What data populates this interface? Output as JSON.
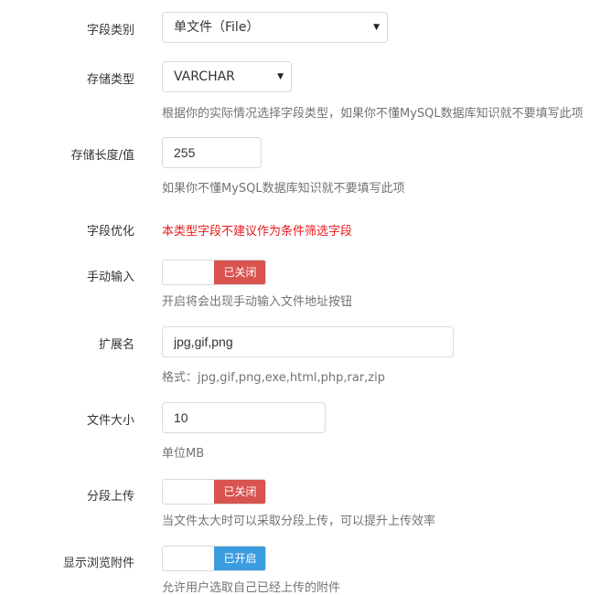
{
  "fields": {
    "field_type": {
      "label": "字段类别",
      "value": "单文件（File）"
    },
    "storage_type": {
      "label": "存储类型",
      "value": "VARCHAR",
      "help": "根据你的实际情况选择字段类型，如果你不懂MySQL数据库知识就不要填写此项"
    },
    "storage_length": {
      "label": "存储长度/值",
      "value": "255",
      "help": "如果你不懂MySQL数据库知识就不要填写此项"
    },
    "optimization": {
      "label": "字段优化",
      "warning": "本类型字段不建议作为条件筛选字段"
    },
    "manual_input": {
      "label": "手动输入",
      "state_text": "已关闭",
      "enabled": false,
      "help": "开启将会出现手动输入文件地址按钮"
    },
    "extensions": {
      "label": "扩展名",
      "value": "jpg,gif,png",
      "help": "格式：jpg,gif,png,exe,html,php,rar,zip"
    },
    "file_size": {
      "label": "文件大小",
      "value": "10",
      "help": "单位MB"
    },
    "chunk_upload": {
      "label": "分段上传",
      "state_text": "已关闭",
      "enabled": false,
      "help": "当文件太大时可以采取分段上传，可以提升上传效率"
    },
    "show_attachments": {
      "label": "显示浏览附件",
      "state_text": "已开启",
      "enabled": true,
      "help": "允许用户选取自己已经上传的附件"
    }
  },
  "icons": {
    "select_caret": "caret-down-icon"
  },
  "colors": {
    "off": "#d9534f",
    "on": "#3c9ce0",
    "warning": "#e7191b",
    "help": "#737373"
  }
}
